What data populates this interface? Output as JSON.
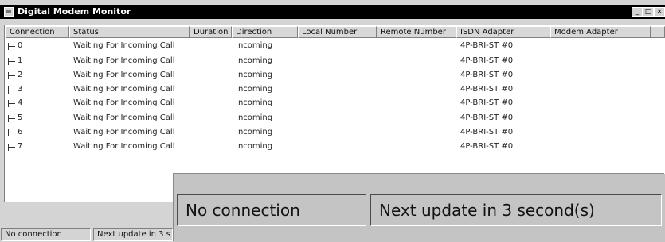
{
  "window": {
    "title": "Digital Modem Monitor",
    "controls": {
      "minimize": "_",
      "maximize": "□",
      "close": "×"
    }
  },
  "columns": [
    "Connection",
    "Status",
    "Duration",
    "Direction",
    "Local Number",
    "Remote Number",
    "ISDN Adapter",
    "Modem Adapter"
  ],
  "rows": [
    {
      "connection": "0",
      "status": "Waiting For Incoming Call",
      "duration": "",
      "direction": "Incoming",
      "local_number": "",
      "remote_number": "",
      "isdn_adapter": "4P-BRI-ST #0",
      "modem_adapter": ""
    },
    {
      "connection": "1",
      "status": "Waiting For Incoming Call",
      "duration": "",
      "direction": "Incoming",
      "local_number": "",
      "remote_number": "",
      "isdn_adapter": "4P-BRI-ST #0",
      "modem_adapter": ""
    },
    {
      "connection": "2",
      "status": "Waiting For Incoming Call",
      "duration": "",
      "direction": "Incoming",
      "local_number": "",
      "remote_number": "",
      "isdn_adapter": "4P-BRI-ST #0",
      "modem_adapter": ""
    },
    {
      "connection": "3",
      "status": "Waiting For Incoming Call",
      "duration": "",
      "direction": "Incoming",
      "local_number": "",
      "remote_number": "",
      "isdn_adapter": "4P-BRI-ST #0",
      "modem_adapter": ""
    },
    {
      "connection": "4",
      "status": "Waiting For Incoming Call",
      "duration": "",
      "direction": "Incoming",
      "local_number": "",
      "remote_number": "",
      "isdn_adapter": "4P-BRI-ST #0",
      "modem_adapter": ""
    },
    {
      "connection": "5",
      "status": "Waiting For Incoming Call",
      "duration": "",
      "direction": "Incoming",
      "local_number": "",
      "remote_number": "",
      "isdn_adapter": "4P-BRI-ST #0",
      "modem_adapter": ""
    },
    {
      "connection": "6",
      "status": "Waiting For Incoming Call",
      "duration": "",
      "direction": "Incoming",
      "local_number": "",
      "remote_number": "",
      "isdn_adapter": "4P-BRI-ST #0",
      "modem_adapter": ""
    },
    {
      "connection": "7",
      "status": "Waiting For Incoming Call",
      "duration": "",
      "direction": "Incoming",
      "local_number": "",
      "remote_number": "",
      "isdn_adapter": "4P-BRI-ST #0",
      "modem_adapter": ""
    }
  ],
  "statusbar": {
    "connection": "No connection",
    "update": "Next update in 3 second(s)",
    "update_truncated": "Next update in 3 s"
  },
  "zoom_callout": {
    "connection": "No connection",
    "update": "Next update in 3 second(s)"
  }
}
